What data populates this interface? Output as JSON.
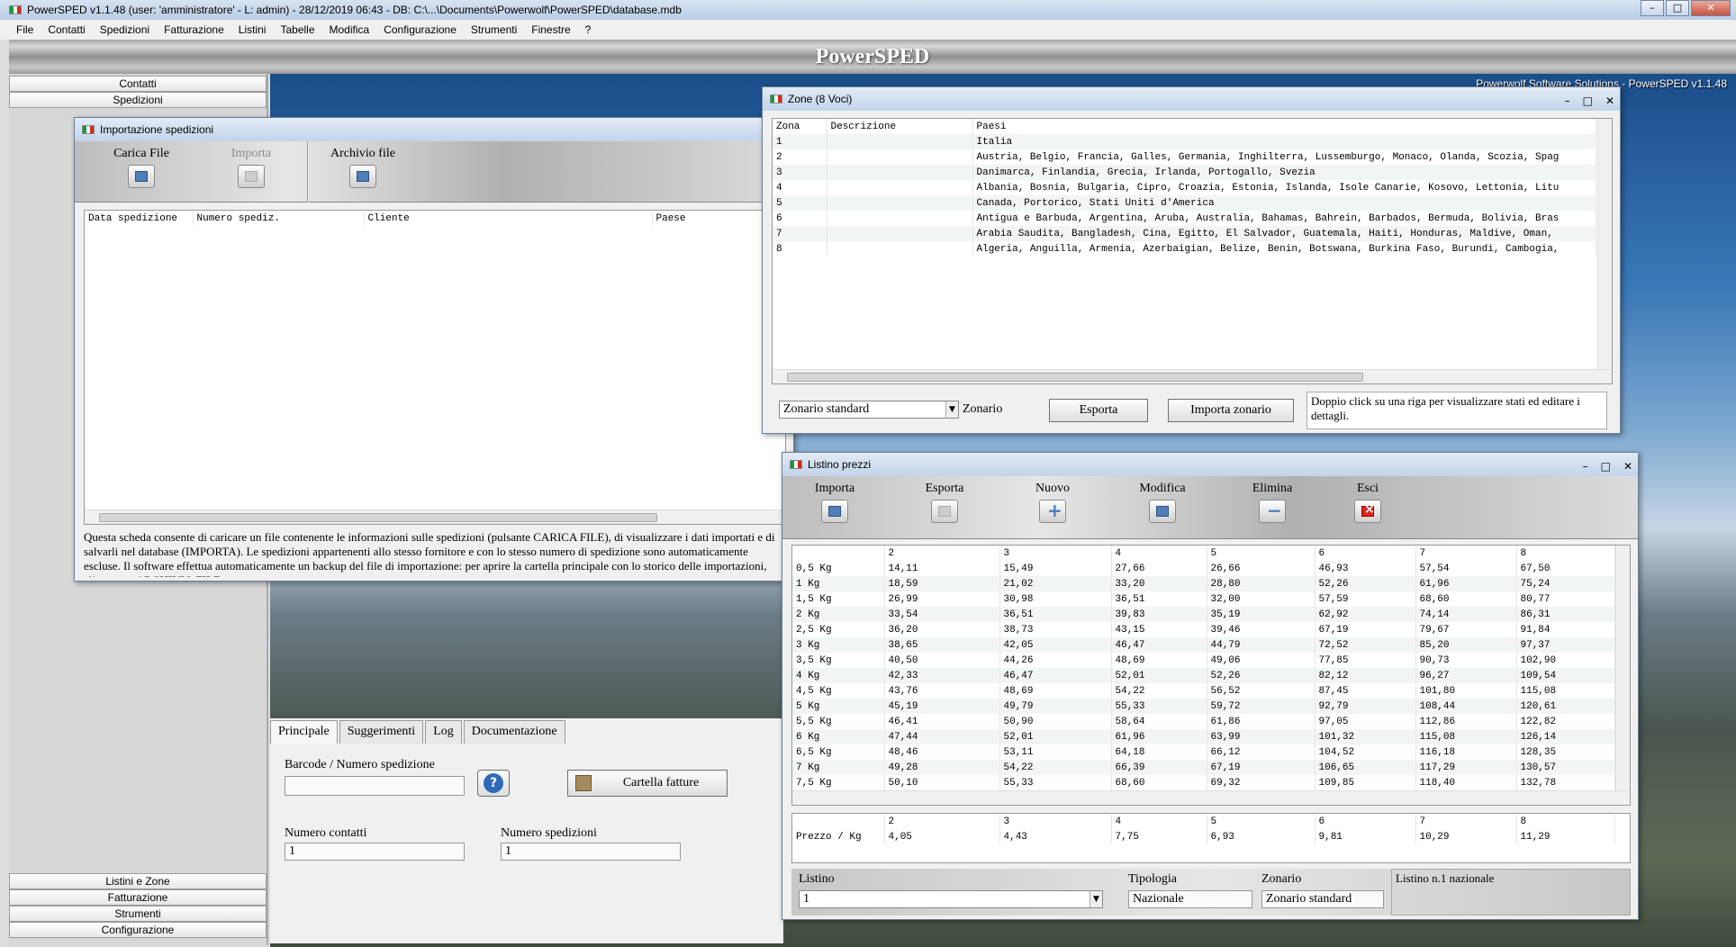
{
  "app": {
    "title": "PowerSPED v1.1.48  (user: 'amministratore'  - L: admin) - 28/12/2019 06:43 - DB: C:\\...\\Documents\\Powerwolf\\PowerSPED\\database.mdb",
    "banner": "PowerSPED",
    "brand": "Powerwolf Software Solutions - PowerSPED v1.1.48",
    "window_controls": [
      "–",
      "□",
      "✕"
    ]
  },
  "menu": [
    "File",
    "Contatti",
    "Spedizioni",
    "Fatturazione",
    "Listini",
    "Tabelle",
    "Modifica",
    "Configurazione",
    "Strumenti",
    "Finestre",
    "?"
  ],
  "sidebar": {
    "top": [
      "Contatti",
      "Spedizioni"
    ],
    "bottom": [
      "Listini e Zone",
      "Fatturazione",
      "Strumenti",
      "Configurazione"
    ]
  },
  "main": {
    "tabs": [
      "Principale",
      "Suggerimenti",
      "Log",
      "Documentazione"
    ],
    "barcode_label": "Barcode / Numero spedizione",
    "barcode_value": "",
    "help_icon": "?",
    "invoice_button": "Cartella fatture",
    "contacts_label": "Numero contatti",
    "contacts_value": "1",
    "shipments_label": "Numero spedizioni",
    "shipments_value": "1"
  },
  "import_window": {
    "title": "Importazione spedizioni",
    "toolbar": {
      "load": "Carica File",
      "import": "Importa",
      "archive": "Archivio file"
    },
    "columns": [
      "Data spedizione",
      "Numero spediz.",
      "Cliente",
      "Paese"
    ],
    "info": "Questa scheda consente di caricare un file contenente le informazioni sulle spedizioni (pulsante CARICA FILE), di visualizzare i dati importati e di salvarli nel database (IMPORTA). Le spedizioni appartenenti allo stesso fornitore e con lo stesso numero di spedizione sono automaticamente escluse. Il software effettua automaticamente un backup del file di importazione: per aprire la cartella principale con lo storico delle importazioni, cliccare su ARCHIVIO FILE."
  },
  "zone_window": {
    "title": "Zone (8 Voci)",
    "columns": [
      "Zona",
      "Descrizione",
      "Paesi"
    ],
    "rows": [
      [
        "1",
        "",
        "Italia"
      ],
      [
        "2",
        "",
        "Austria, Belgio, Francia, Galles, Germania, Inghilterra, Lussemburgo, Monaco, Olanda, Scozia, Spag"
      ],
      [
        "3",
        "",
        "Danimarca, Finlandia, Grecia, Irlanda, Portogallo, Svezia"
      ],
      [
        "4",
        "",
        "Albania, Bosnia, Bulgaria, Cipro, Croazia, Estonia, Islanda, Isole Canarie, Kosovo, Lettonia, Litu"
      ],
      [
        "5",
        "",
        "Canada, Portorico, Stati Uniti d'America"
      ],
      [
        "6",
        "",
        "Antigua e Barbuda, Argentina, Aruba, Australia, Bahamas, Bahrein, Barbados, Bermuda, Bolivia, Bras"
      ],
      [
        "7",
        "",
        "Arabia Saudita, Bangladesh, Cina, Egitto, El Salvador, Guatemala, Haiti, Honduras, Maldive, Oman,"
      ],
      [
        "8",
        "",
        "Algeria, Anguilla, Armenia, Azerbaigian, Belize, Benin, Botswana, Burkina Faso, Burundi, Cambogia,"
      ]
    ],
    "zonario_select": "Zonario standard",
    "zonario_label": "Zonario",
    "export_button": "Esporta",
    "import_button": "Importa zonario",
    "hint": "Doppio click su una riga per visualizzare stati ed editare i dettagli."
  },
  "price_window": {
    "title": "Listino prezzi",
    "toolbar": {
      "import": "Importa",
      "export": "Esporta",
      "new": "Nuovo",
      "edit": "Modifica",
      "delete": "Elimina",
      "exit": "Esci"
    },
    "columns": [
      "",
      "2",
      "3",
      "4",
      "5",
      "6",
      "7",
      "8"
    ],
    "rows": [
      [
        "0,5 Kg",
        "14,11",
        "15,49",
        "27,66",
        "26,66",
        "46,93",
        "57,54",
        "67,50"
      ],
      [
        "1 Kg",
        "18,59",
        "21,02",
        "33,20",
        "28,80",
        "52,26",
        "61,96",
        "75,24"
      ],
      [
        "1,5 Kg",
        "26,99",
        "30,98",
        "36,51",
        "32,00",
        "57,59",
        "68,60",
        "80,77"
      ],
      [
        "2 Kg",
        "33,54",
        "36,51",
        "39,83",
        "35,19",
        "62,92",
        "74,14",
        "86,31"
      ],
      [
        "2,5 Kg",
        "36,20",
        "38,73",
        "43,15",
        "39,46",
        "67,19",
        "79,67",
        "91,84"
      ],
      [
        "3 Kg",
        "38,65",
        "42,05",
        "46,47",
        "44,79",
        "72,52",
        "85,20",
        "97,37"
      ],
      [
        "3,5 Kg",
        "40,50",
        "44,26",
        "48,69",
        "49,06",
        "77,85",
        "90,73",
        "102,90"
      ],
      [
        "4 Kg",
        "42,33",
        "46,47",
        "52,01",
        "52,26",
        "82,12",
        "96,27",
        "109,54"
      ],
      [
        "4,5 Kg",
        "43,76",
        "48,69",
        "54,22",
        "56,52",
        "87,45",
        "101,80",
        "115,08"
      ],
      [
        "5 Kg",
        "45,19",
        "49,79",
        "55,33",
        "59,72",
        "92,79",
        "108,44",
        "120,61"
      ],
      [
        "5,5 Kg",
        "46,41",
        "50,90",
        "58,64",
        "61,86",
        "97,05",
        "112,86",
        "122,82"
      ],
      [
        "6 Kg",
        "47,44",
        "52,01",
        "61,96",
        "63,99",
        "101,32",
        "115,08",
        "126,14"
      ],
      [
        "6,5 Kg",
        "48,46",
        "53,11",
        "64,18",
        "66,12",
        "104,52",
        "116,18",
        "128,35"
      ],
      [
        "7 Kg",
        "49,28",
        "54,22",
        "66,39",
        "67,19",
        "106,65",
        "117,29",
        "130,57"
      ],
      [
        "7,5 Kg",
        "50,10",
        "55,33",
        "68,60",
        "69,32",
        "109,85",
        "118,40",
        "132,78"
      ]
    ],
    "per_kg_columns": [
      "",
      "2",
      "3",
      "4",
      "5",
      "6",
      "7",
      "8"
    ],
    "per_kg_row": [
      "Prezzo / Kg",
      "4,05",
      "4,43",
      "7,75",
      "6,93",
      "9,81",
      "10,29",
      "11,29"
    ],
    "listino_label": "Listino",
    "listino_value": "1",
    "tipologia_label": "Tipologia",
    "tipologia_value": "Nazionale",
    "zonario_label": "Zonario",
    "zonario_value": "Zonario standard",
    "note": "Listino n.1 nazionale"
  }
}
